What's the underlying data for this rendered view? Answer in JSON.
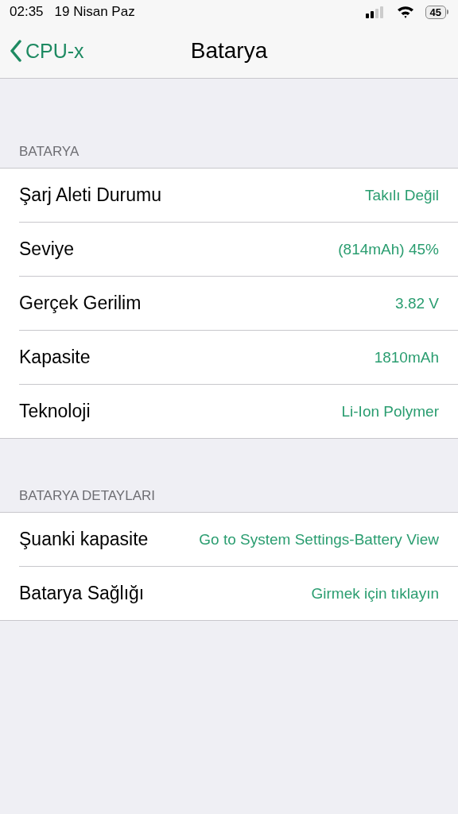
{
  "status_bar": {
    "time": "02:35",
    "date": "19 Nisan Paz",
    "battery": "45"
  },
  "nav": {
    "back": "CPU-x",
    "title": "Batarya"
  },
  "sections": [
    {
      "header": "BATARYA",
      "rows": [
        {
          "label": "Şarj Aleti Durumu",
          "value": "Takılı Değil"
        },
        {
          "label": "Seviye",
          "value": "(814mAh) 45%"
        },
        {
          "label": "Gerçek Gerilim",
          "value": "3.82 V"
        },
        {
          "label": "Kapasite",
          "value": "1810mAh"
        },
        {
          "label": "Teknoloji",
          "value": "Li-Ion Polymer"
        }
      ]
    },
    {
      "header": "BATARYA DETAYLARI",
      "rows": [
        {
          "label": "Şuanki kapasite",
          "value": "Go to System Settings-Battery View"
        },
        {
          "label": "Batarya Sağlığı",
          "value": "Girmek için tıklayın"
        }
      ]
    }
  ]
}
